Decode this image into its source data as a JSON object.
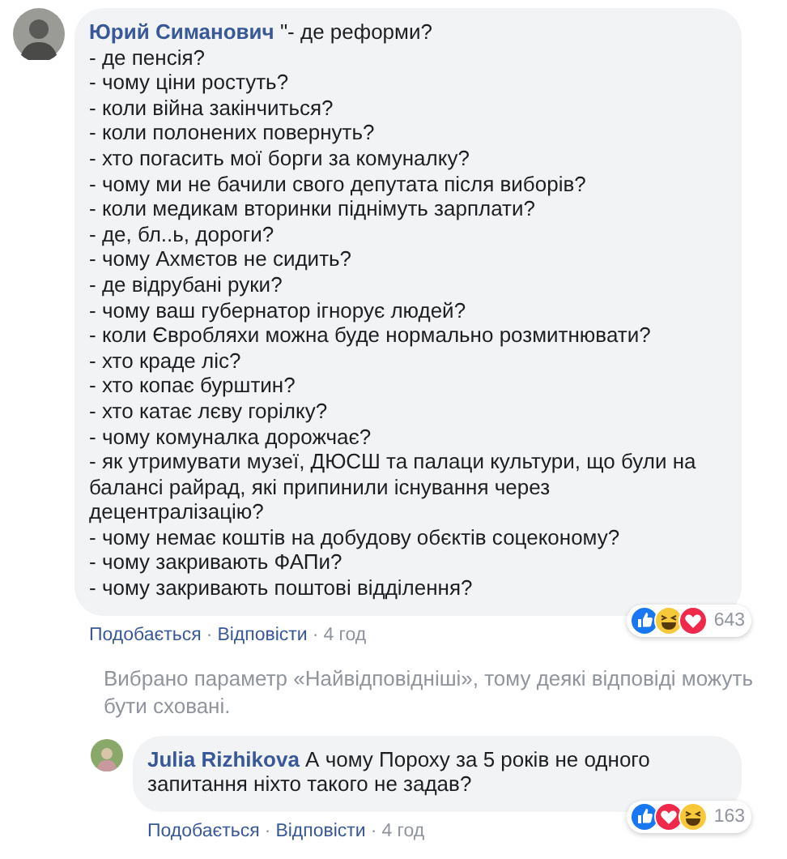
{
  "comment": {
    "author": "Юрий Симанович",
    "text": "\"- де реформи?\n- де пенсія?\n- чому ціни ростуть?\n- коли війна закінчиться?\n- коли полонених повернуть?\n- хто погасить мої борги за комуналку?\n- чому ми не бачили свого депутата після виборів?\n- коли медикам вторинки піднімуть зарплати?\n- де, бл..ь, дороги?\n- чому Ахмєтов не сидить?\n- де відрубані руки?\n- чому ваш губернатор ігнорує людей?\n- коли Євробляхи можна буде нормально розмитнювати?\n- хто краде ліс?\n- хто копає бурштин?\n- хто катає лєву горілку?\n- чому комуналка дорожчає?\n- як утримувати музеї, ДЮСШ та палаци культури, що були на балансі райрад, які припинили існування через децентралізацію?\n- чому немає коштів на добудову обєктів соцеконому?\n- чому закривають ФАПи?\n- чому закривають поштові відділення?",
    "reactions": [
      {
        "kind": "like"
      },
      {
        "kind": "haha"
      },
      {
        "kind": "love"
      }
    ],
    "reaction_count": "643",
    "actions": [
      "Подобається",
      "Відповісти"
    ],
    "separator": "·",
    "time": "4 год"
  },
  "notice": "Вибрано параметр «Найвідповідніші», тому деякі відповіді можуть бути сховані.",
  "reply": {
    "author": "Julia Rizhikova",
    "text": "А чому Пороху за 5 років не одного запитання ніхто такого не задав?",
    "reactions": [
      {
        "kind": "like"
      },
      {
        "kind": "love"
      },
      {
        "kind": "haha"
      }
    ],
    "reaction_count": "163",
    "actions": [
      "Подобається",
      "Відповісти"
    ],
    "separator": "·",
    "time": "4 год"
  }
}
